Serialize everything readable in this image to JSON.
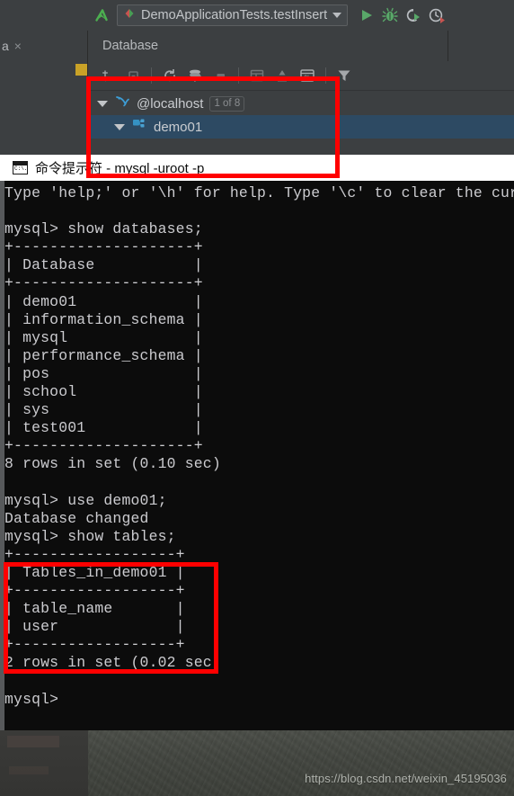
{
  "ide": {
    "toolbar": {
      "back_icon": "back-arrow-icon",
      "run_config_name": "DemoApplicationTests.testInsert",
      "run_config_icon": "run-config-split-icon",
      "dropdown_icon": "chevron-down-icon",
      "run_icon": "run-play-icon",
      "debug_icon": "debug-bug-icon",
      "coverage_icon": "run-with-coverage-icon",
      "profiler_icon": "profiler-clock-icon"
    },
    "tabs": {
      "left_tab_label": "a",
      "left_tab_close": "×",
      "database_tab_label": "Database"
    },
    "db_toolbar": {
      "icons": [
        "add-new-icon",
        "remove-icon",
        "refresh-icon",
        "sync-filter-icon",
        "stop-icon",
        "open-console-icon",
        "jump-to-editor-icon",
        "data-source-properties-icon",
        "filter-funnel-icon"
      ]
    },
    "tree": {
      "items": [
        {
          "label": "@localhost",
          "badge": "1 of 8",
          "icon": "mysql-dolphin-icon",
          "expander": "expanded-triangle-icon",
          "selected": false,
          "level": 0
        },
        {
          "label": "demo01",
          "badge": "",
          "icon": "schema-icon",
          "expander": "expanded-triangle-icon",
          "selected": true,
          "level": 1
        }
      ]
    }
  },
  "cmd": {
    "title": "命令提示符 - mysql  -uroot -p",
    "title_icon": "cmd-console-icon",
    "icon_text": "C:\\.",
    "console": "Type 'help;' or '\\h' for help. Type '\\c' to clear the cur\n\nmysql> show databases;\n+--------------------+\n| Database           |\n+--------------------+\n| demo01             |\n| information_schema |\n| mysql              |\n| performance_schema |\n| pos                |\n| school             |\n| sys                |\n| test001            |\n+--------------------+\n8 rows in set (0.10 sec)\n\nmysql> use demo01;\nDatabase changed\nmysql> show tables;\n+------------------+\n| Tables_in_demo01 |\n+------------------+\n| table_name       |\n| user             |\n+------------------+\n2 rows in set (0.02 sec)\n\nmysql>"
  },
  "annotations": {
    "box1_name": "highlight-database-tree",
    "box2_name": "highlight-show-tables-result",
    "color": "#ff0000"
  },
  "watermark": {
    "text": "https://blog.csdn.net/weixin_45195036"
  },
  "colors": {
    "ide_background": "#3c3f41",
    "tree_selection": "#2d4a63",
    "console_background": "#0c0c0c",
    "console_text": "#ccccd0",
    "title_bar": "#ffffff",
    "accent_red": "#ff0000",
    "run_green": "#4caf50"
  }
}
